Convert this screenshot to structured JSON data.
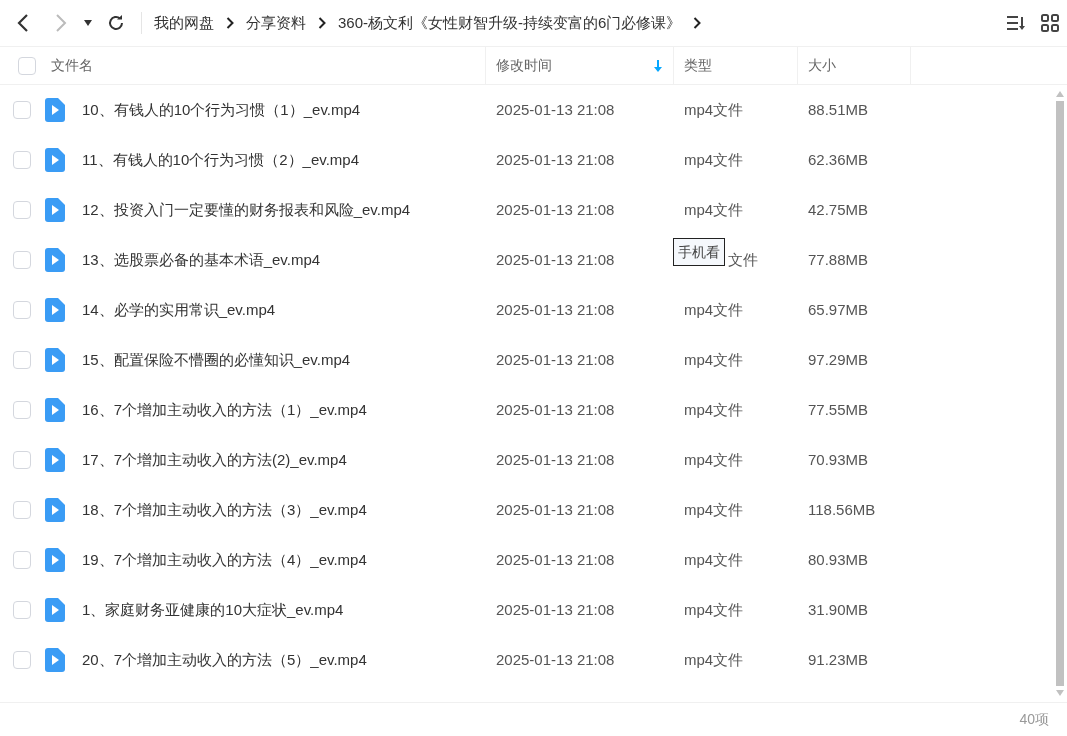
{
  "toolbar": {
    "breadcrumb": [
      "我的网盘",
      "分享资料",
      "360-杨文利《女性财智升级-持续变富的6门必修课》"
    ]
  },
  "table": {
    "all_checked": false,
    "columns": [
      {
        "label": "文件名",
        "sorted": false
      },
      {
        "label": "修改时间",
        "sorted": true
      },
      {
        "label": "类型",
        "sorted": false
      },
      {
        "label": "大小",
        "sorted": false
      }
    ],
    "rows": [
      {
        "name": "10、有钱人的10个行为习惯（1）_ev.mp4",
        "modified": "2025-01-13 21:08",
        "type": "mp4文件",
        "size": "88.51MB",
        "checked": false
      },
      {
        "name": "11、有钱人的10个行为习惯（2）_ev.mp4",
        "modified": "2025-01-13 21:08",
        "type": "mp4文件",
        "size": "62.36MB",
        "checked": false
      },
      {
        "name": "12、投资入门一定要懂的财务报表和风险_ev.mp4",
        "modified": "2025-01-13 21:08",
        "type": "mp4文件",
        "size": "42.75MB",
        "checked": false
      },
      {
        "name": "13、选股票必备的基本术语_ev.mp4",
        "modified": "2025-01-13 21:08",
        "type": "文件",
        "size": "77.88MB",
        "checked": false,
        "tooltip": "手机看"
      },
      {
        "name": "14、必学的实用常识_ev.mp4",
        "modified": "2025-01-13 21:08",
        "type": "mp4文件",
        "size": "65.97MB",
        "checked": false
      },
      {
        "name": "15、配置保险不懵圈的必懂知识_ev.mp4",
        "modified": "2025-01-13 21:08",
        "type": "mp4文件",
        "size": "97.29MB",
        "checked": false
      },
      {
        "name": "16、7个增加主动收入的方法（1）_ev.mp4",
        "modified": "2025-01-13 21:08",
        "type": "mp4文件",
        "size": "77.55MB",
        "checked": false
      },
      {
        "name": "17、7个增加主动收入的方法(2)_ev.mp4",
        "modified": "2025-01-13 21:08",
        "type": "mp4文件",
        "size": "70.93MB",
        "checked": false
      },
      {
        "name": "18、7个增加主动收入的方法（3）_ev.mp4",
        "modified": "2025-01-13 21:08",
        "type": "mp4文件",
        "size": "118.56MB",
        "checked": false
      },
      {
        "name": "19、7个增加主动收入的方法（4）_ev.mp4",
        "modified": "2025-01-13 21:08",
        "type": "mp4文件",
        "size": "80.93MB",
        "checked": false
      },
      {
        "name": "1、家庭财务亚健康的10大症状_ev.mp4",
        "modified": "2025-01-13 21:08",
        "type": "mp4文件",
        "size": "31.90MB",
        "checked": false
      },
      {
        "name": "20、7个增加主动收入的方法（5）_ev.mp4",
        "modified": "2025-01-13 21:08",
        "type": "mp4文件",
        "size": "91.23MB",
        "checked": false
      }
    ]
  },
  "status_bar": {
    "count": "40项"
  }
}
